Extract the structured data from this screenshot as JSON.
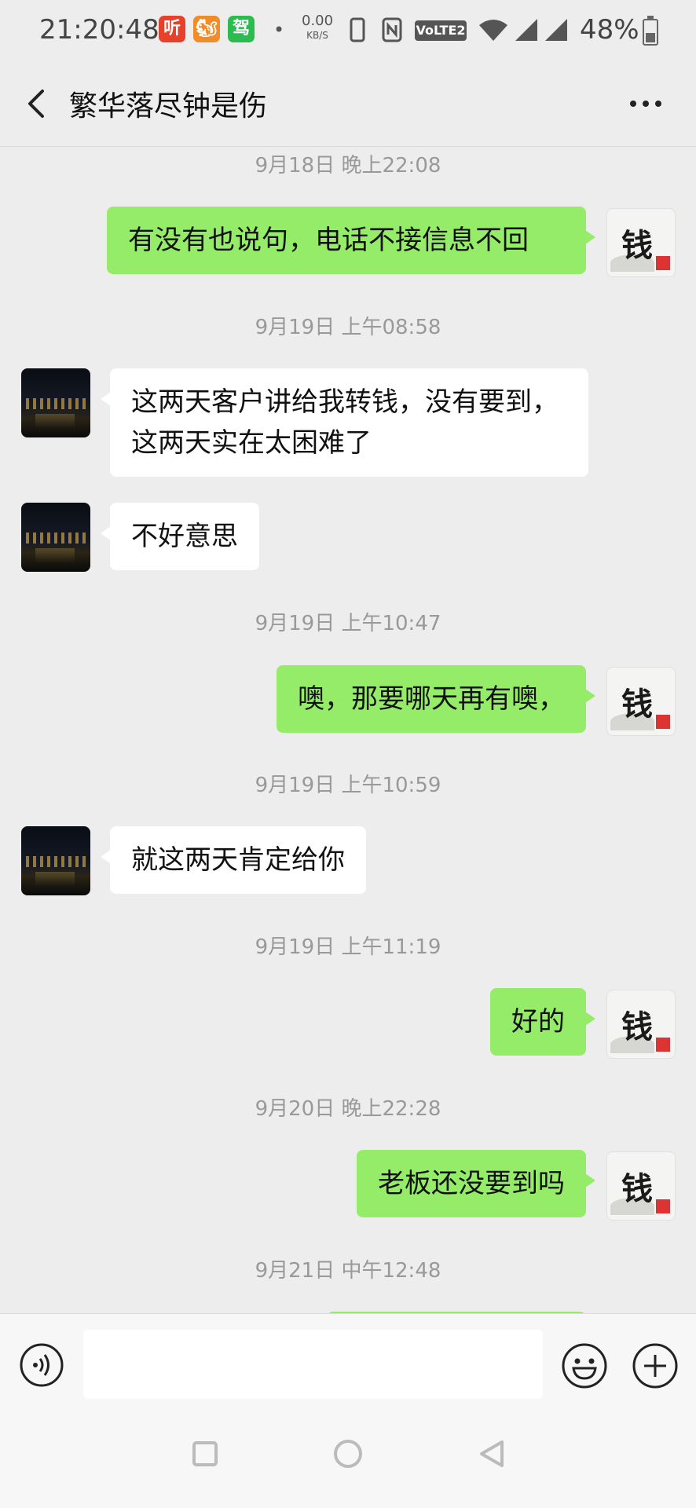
{
  "status_bar": {
    "time": "21:20:48",
    "app_icons": [
      {
        "name": "ting-app-icon",
        "glyph": "听",
        "color": "#e8412b"
      },
      {
        "name": "squirrel-app-icon",
        "glyph": "🐿",
        "color": "#f08c2a"
      },
      {
        "name": "jiakao-app-icon",
        "glyph": "驾",
        "color": "#2bbb4f"
      }
    ],
    "speed_value": "0.00",
    "speed_unit": "KB/S",
    "volte": "VoLTE2",
    "battery": "48%"
  },
  "header": {
    "title": "繁华落尽钟是伤"
  },
  "messages": [
    {
      "type": "time",
      "text": "9月18日 晚上22:08"
    },
    {
      "type": "out",
      "text": "有没有也说句，电话不接信息不回"
    },
    {
      "type": "time",
      "text": "9月19日 上午08:58"
    },
    {
      "type": "in",
      "text": "这两天客户讲给我转钱，没有要到，这两天实在太困难了"
    },
    {
      "type": "in",
      "text": "不好意思"
    },
    {
      "type": "time",
      "text": "9月19日 上午10:47"
    },
    {
      "type": "out",
      "text": "噢，那要哪天再有噢，"
    },
    {
      "type": "time",
      "text": "9月19日 上午10:59"
    },
    {
      "type": "in",
      "text": "就这两天肯定给你"
    },
    {
      "type": "time",
      "text": "9月19日 上午11:19"
    },
    {
      "type": "out",
      "text": "好的"
    },
    {
      "type": "time",
      "text": "9月20日 晚上22:28"
    },
    {
      "type": "out",
      "text": "老板还没要到吗"
    },
    {
      "type": "time",
      "text": "9月21日 中午12:48"
    }
  ],
  "my_avatar_char": "钱",
  "colors": {
    "outgoing_bubble": "#95ec69",
    "incoming_bubble": "#ffffff",
    "background": "#ededed"
  },
  "input": {
    "value": ""
  }
}
